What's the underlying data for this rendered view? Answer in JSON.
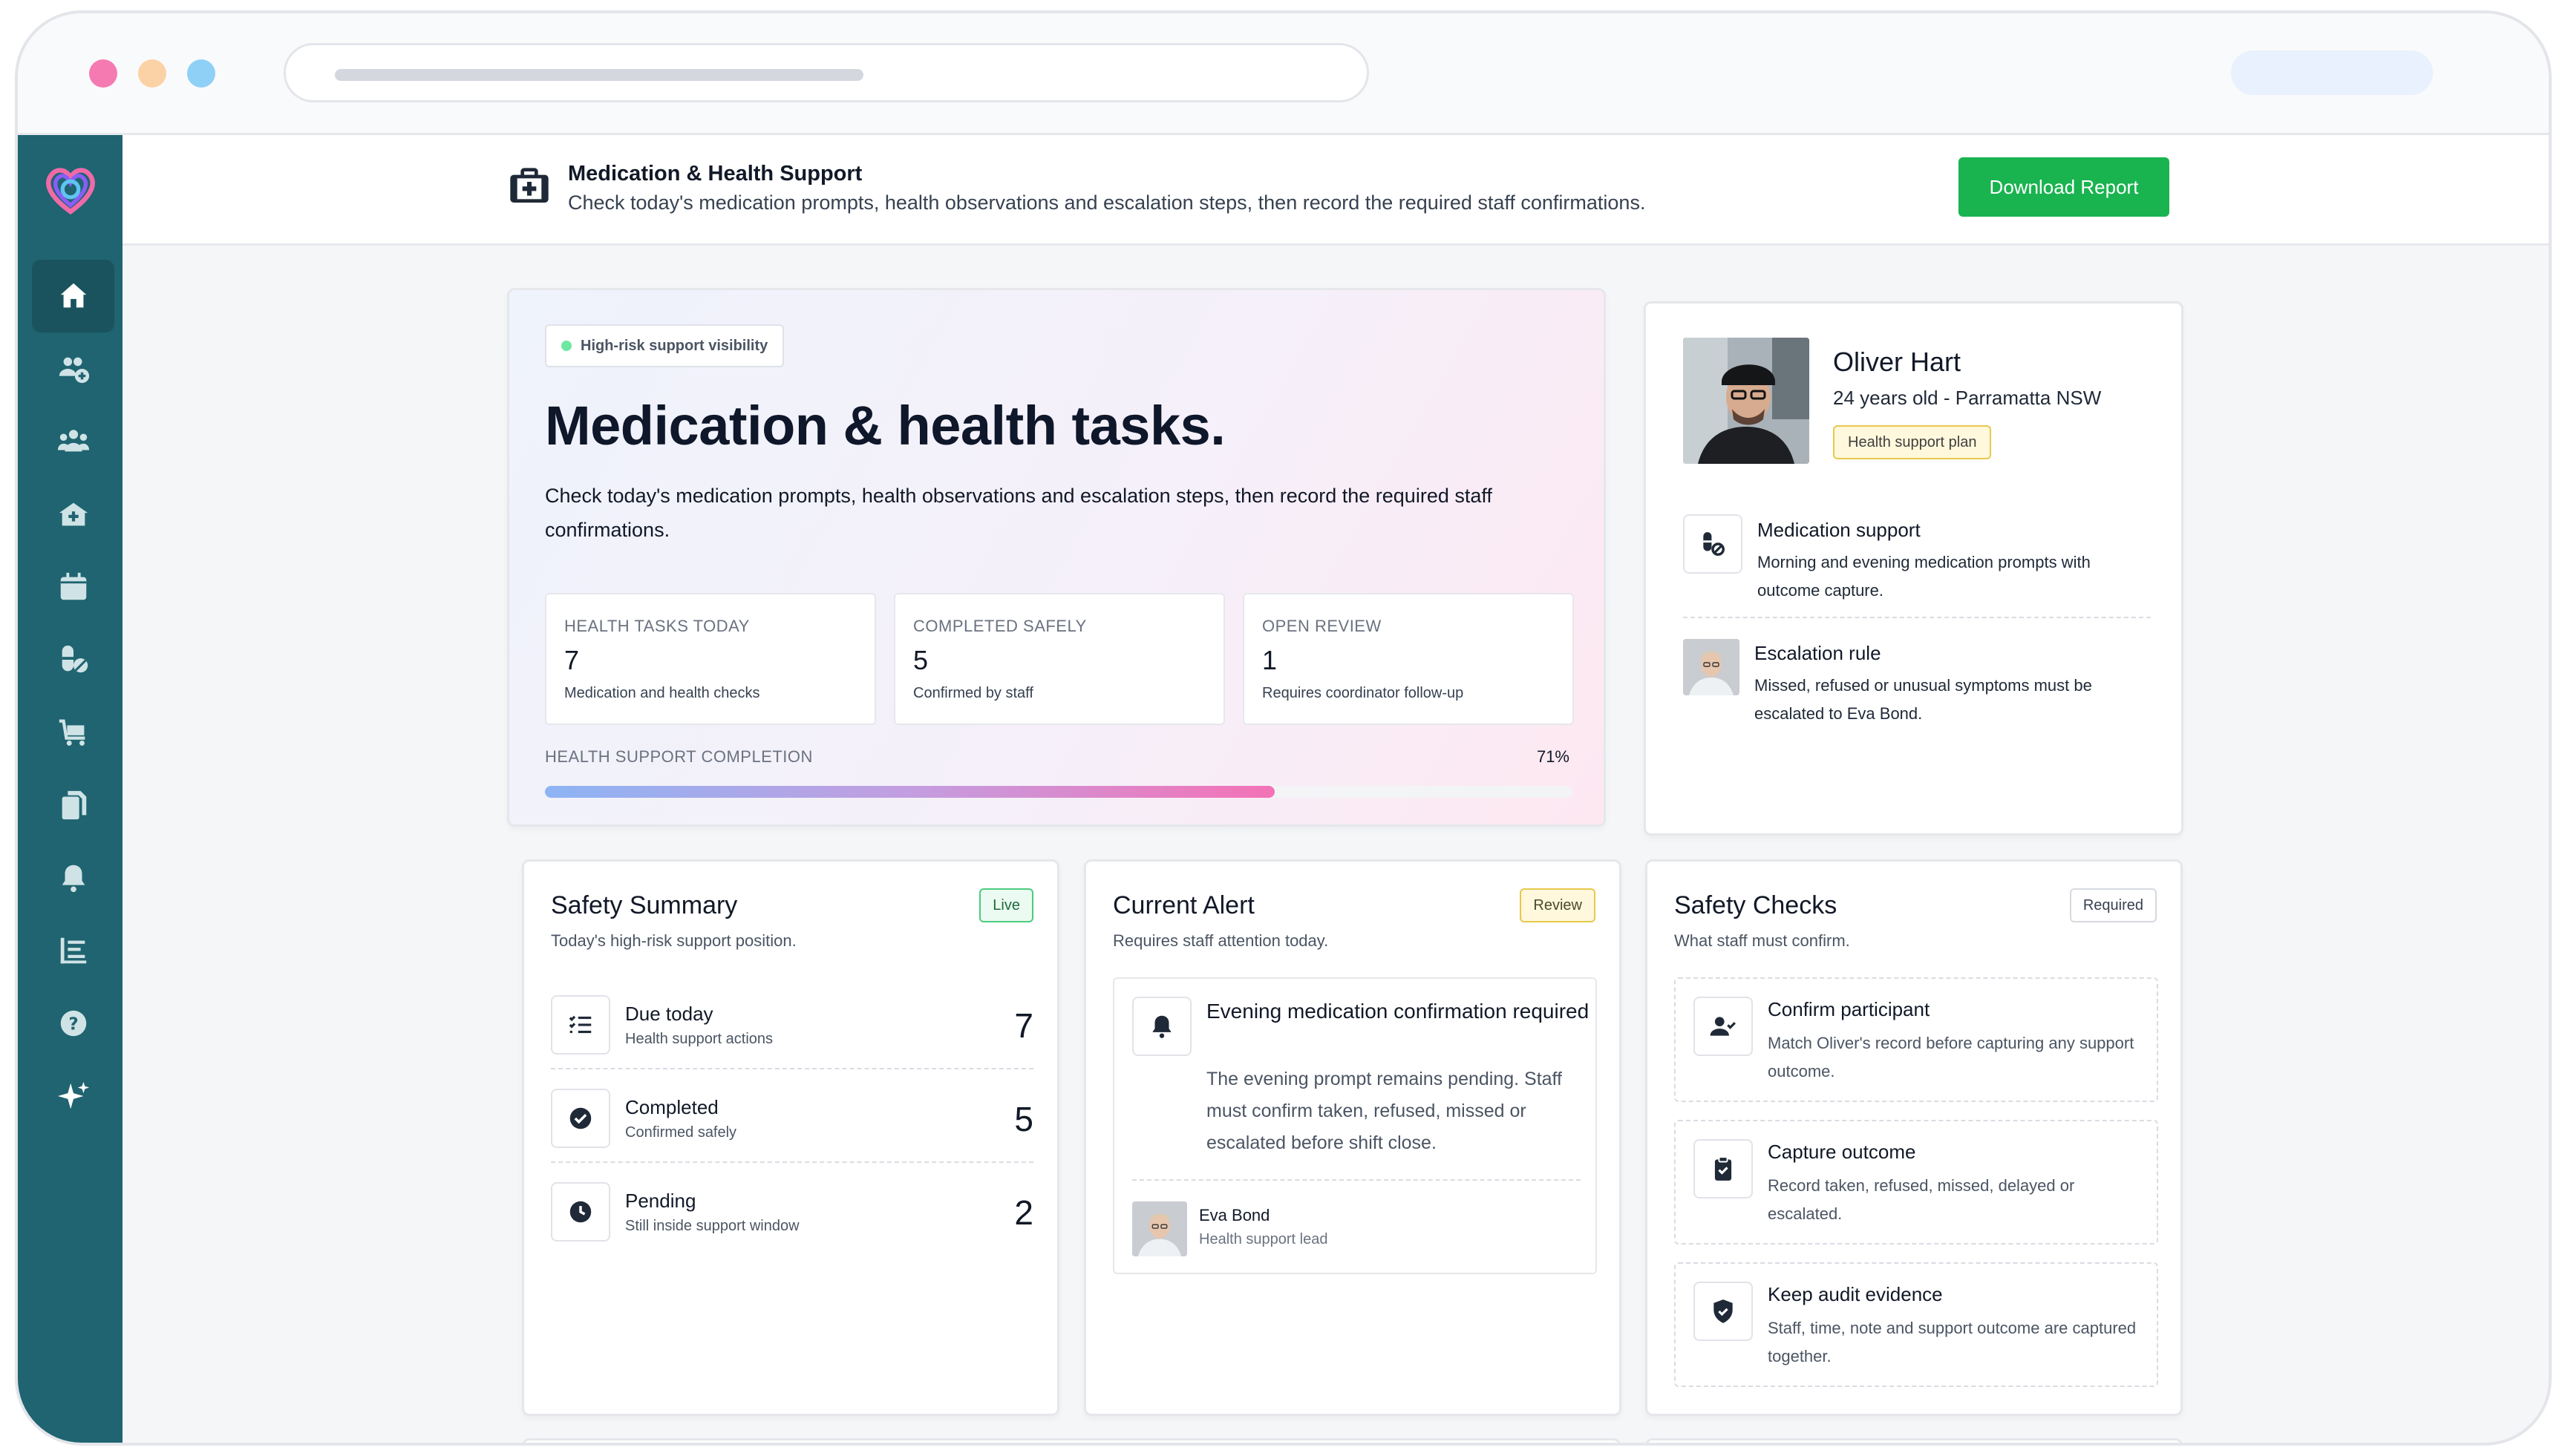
{
  "header": {
    "title": "Medication & Health Support",
    "subtitle": "Check today's medication prompts, health observations and escalation steps, then record the required staff confirmations.",
    "download_label": "Download Report"
  },
  "sidebar": {
    "items": [
      {
        "icon": "home-icon",
        "active": true
      },
      {
        "icon": "add-group-icon"
      },
      {
        "icon": "people-icon"
      },
      {
        "icon": "house-medical-icon"
      },
      {
        "icon": "calendar-icon"
      },
      {
        "icon": "pills-icon"
      },
      {
        "icon": "cart-icon"
      },
      {
        "icon": "documents-icon"
      },
      {
        "icon": "bell-icon"
      },
      {
        "icon": "list-icon"
      },
      {
        "icon": "help-icon"
      },
      {
        "icon": "sparkle-icon"
      }
    ]
  },
  "hero": {
    "badge": "High-risk support visibility",
    "title": "Medication & health tasks.",
    "description": "Check today's medication prompts, health observations and escalation steps, then record the required staff confirmations.",
    "stats": [
      {
        "label": "HEALTH TASKS TODAY",
        "value": "7",
        "sub": "Medication and health checks"
      },
      {
        "label": "COMPLETED SAFELY",
        "value": "5",
        "sub": "Confirmed by staff"
      },
      {
        "label": "OPEN REVIEW",
        "value": "1",
        "sub": "Requires coordinator follow-up"
      }
    ],
    "progress_label": "HEALTH SUPPORT COMPLETION",
    "progress_text": "71%",
    "progress_value": 0.71
  },
  "profile": {
    "name": "Oliver Hart",
    "meta": "24 years old - Parramatta NSW",
    "plan": "Health support plan",
    "medication_title": "Medication support",
    "medication_text": "Morning and evening medication prompts with outcome capture.",
    "escalation_title": "Escalation rule",
    "escalation_text": "Missed, refused or unusual symptoms must be escalated to Eva Bond."
  },
  "safety": {
    "title": "Safety Summary",
    "subtitle": "Today's high-risk support position.",
    "tag": "Live",
    "rows": [
      {
        "label": "Due today",
        "sub": "Health support actions",
        "value": "7"
      },
      {
        "label": "Completed",
        "sub": "Confirmed safely",
        "value": "5"
      },
      {
        "label": "Pending",
        "sub": "Still inside support window",
        "value": "2"
      }
    ]
  },
  "alert": {
    "title": "Current Alert",
    "subtitle": "Requires staff attention today.",
    "tag": "Review",
    "item_title": "Evening medication confirmation required",
    "item_text": "The evening prompt remains pending. Staff must confirm taken, refused, missed or escalated before shift close.",
    "person_name": "Eva Bond",
    "person_role": "Health support lead"
  },
  "checks": {
    "title": "Safety Checks",
    "subtitle": "What staff must confirm.",
    "tag": "Required",
    "items": [
      {
        "title": "Confirm participant",
        "text": "Match Oliver's record before capturing any support outcome."
      },
      {
        "title": "Capture outcome",
        "text": "Record taken, refused, missed, delayed or escalated."
      },
      {
        "title": "Keep audit evidence",
        "text": "Staff, time, note and support outcome are captured together."
      }
    ]
  },
  "colors": {
    "sidebar": "#1f6470",
    "accent_green": "#19b34f",
    "progress_gradient": [
      "#8db4f4",
      "#c39ee0",
      "#f472b6"
    ]
  }
}
